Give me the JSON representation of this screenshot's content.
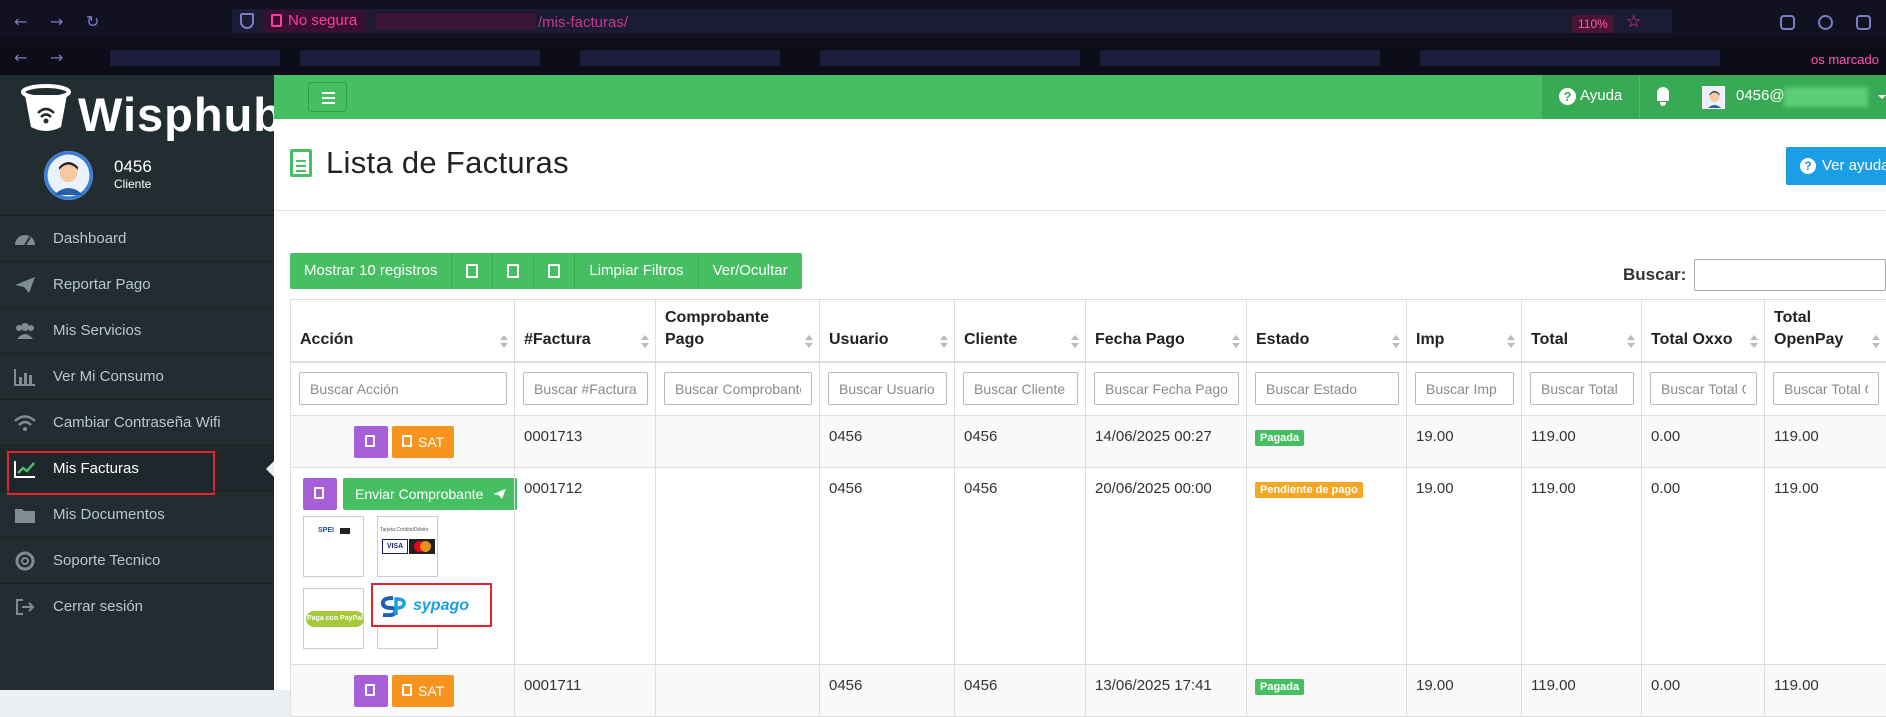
{
  "browser": {
    "security_label": "No segura",
    "url_path": "/mis-facturas/",
    "zoom": "110%",
    "bookmarks_text": "os marcado"
  },
  "sidebar": {
    "brand": "Wisphub",
    "user": {
      "name": "0456",
      "role": "Cliente"
    },
    "items": [
      {
        "label": "Dashboard",
        "icon": "dashboard-icon"
      },
      {
        "label": "Reportar Pago",
        "icon": "paper-plane-icon"
      },
      {
        "label": "Mis Servicios",
        "icon": "users-icon"
      },
      {
        "label": "Ver Mi Consumo",
        "icon": "bar-chart-icon"
      },
      {
        "label": "Cambiar Contraseña Wifi",
        "icon": "wifi-icon"
      },
      {
        "label": "Mis Facturas",
        "icon": "line-chart-icon",
        "active": true
      },
      {
        "label": "Mis Documentos",
        "icon": "folder-icon"
      },
      {
        "label": "Soporte Tecnico",
        "icon": "life-ring-icon"
      },
      {
        "label": "Cerrar sesión",
        "icon": "sign-out-icon"
      }
    ]
  },
  "header": {
    "help_label": "Ayuda",
    "user_label": "0456@"
  },
  "page": {
    "title": "Lista de Facturas",
    "help_button": "Ver ayuda"
  },
  "toolbar": {
    "show_records": "Mostrar 10 registros",
    "clear_filters": "Limpiar Filtros",
    "show_hide": "Ver/Ocultar",
    "search_label": "Buscar:"
  },
  "table": {
    "columns": [
      {
        "label": "Acción",
        "placeholder": "Buscar Acción"
      },
      {
        "label": "#Factura",
        "placeholder": "Buscar #Factura"
      },
      {
        "label": "Comprobante\nPago",
        "placeholder": "Buscar Comprobante"
      },
      {
        "label": "Usuario",
        "placeholder": "Buscar Usuario"
      },
      {
        "label": "Cliente",
        "placeholder": "Buscar Cliente"
      },
      {
        "label": "Fecha Pago",
        "placeholder": "Buscar Fecha Pago"
      },
      {
        "label": "Estado",
        "placeholder": "Buscar Estado"
      },
      {
        "label": "Imp",
        "placeholder": "Buscar Imp"
      },
      {
        "label": "Total",
        "placeholder": "Buscar Total"
      },
      {
        "label": "Total Oxxo",
        "placeholder": "Buscar Total Oxxo"
      },
      {
        "label": "Total\nOpenPay",
        "placeholder": "Buscar Total OpenPay"
      }
    ],
    "rows": [
      {
        "factura": "0001713",
        "usuario": "0456",
        "cliente": "0456",
        "fecha": "14/06/2025 00:27",
        "estado": "Pagada",
        "imp": "19.00",
        "total": "119.00",
        "oxxo": "0.00",
        "openpay": "119.00"
      },
      {
        "factura": "0001712",
        "usuario": "0456",
        "cliente": "0456",
        "fecha": "20/06/2025 00:00",
        "estado": "Pendiente de pago",
        "imp": "19.00",
        "total": "119.00",
        "oxxo": "0.00",
        "openpay": "119.00"
      },
      {
        "factura": "0001711",
        "usuario": "0456",
        "cliente": "0456",
        "fecha": "13/06/2025 17:41",
        "estado": "Pagada",
        "imp": "19.00",
        "total": "119.00",
        "oxxo": "0.00",
        "openpay": "119.00"
      }
    ],
    "action_labels": {
      "sat": "SAT",
      "send_receipt": "Enviar Comprobante"
    },
    "payment_methods": {
      "spei": "SPEI",
      "card_caption": "Tarjeta Crédito/Débito",
      "visa": "VISA",
      "paypal": "Paga con PayPal",
      "sypago": "sypago"
    }
  },
  "colors": {
    "brand_green": "#46bf63",
    "sidebar_bg": "#222d32",
    "purple": "#a65fd6",
    "orange": "#f7941d",
    "highlight_red": "#e5232a"
  }
}
